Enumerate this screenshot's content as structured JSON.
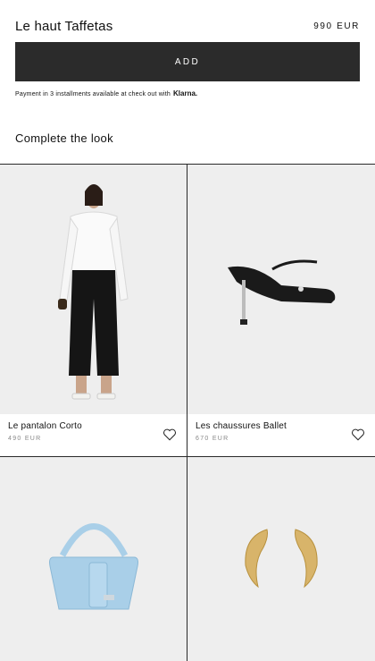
{
  "product": {
    "title": "Le haut Taffetas",
    "price": "990 EUR"
  },
  "add_button": {
    "label": "ADD"
  },
  "payment": {
    "text": "Payment in 3 installments available at check out with",
    "brand": "Klarna."
  },
  "complete_look": {
    "heading": "Complete the look",
    "items": [
      {
        "name": "Le pantalon Corto",
        "price": "490 EUR",
        "icon": "heart-icon"
      },
      {
        "name": "Les chaussures Ballet",
        "price": "670 EUR",
        "icon": "heart-icon"
      }
    ]
  },
  "colors": {
    "button_bg": "#2b2b2b",
    "image_bg": "#eeeeee",
    "bag_blue": "#a9cfe8",
    "earring_gold": "#d8b46a"
  }
}
